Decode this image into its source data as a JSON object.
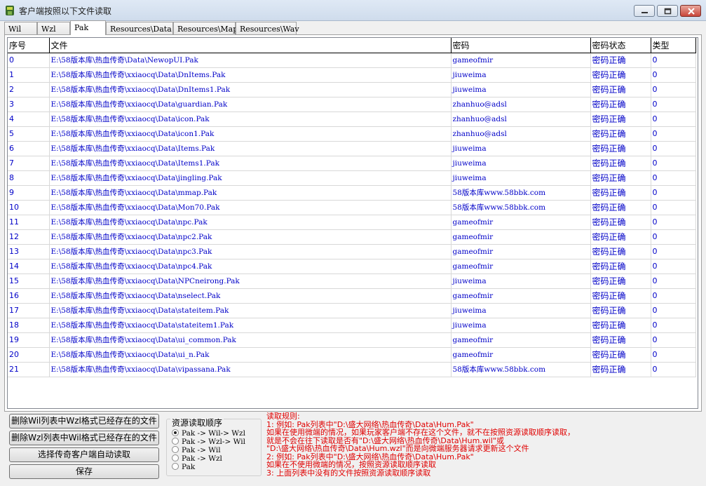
{
  "window": {
    "title": "客户端按照以下文件读取"
  },
  "tabs": [
    "Wil",
    "Wzl",
    "Pak",
    "Resources\\Data",
    "Resources\\Map",
    "Resources\\Wav"
  ],
  "active_tab": "Pak",
  "table": {
    "headers": [
      "序号",
      "文件",
      "密码",
      "密码状态",
      "类型"
    ],
    "rows": [
      [
        "0",
        "E:\\58版本库\\热血传奇\\Data\\NewopUI.Pak",
        "gameofmir",
        "密码正确",
        "0"
      ],
      [
        "1",
        "E:\\58版本库\\热血传奇\\xxiaocq\\Data\\DnItems.Pak",
        "jiuweima",
        "密码正确",
        "0"
      ],
      [
        "2",
        "E:\\58版本库\\热血传奇\\xxiaocq\\Data\\DnItems1.Pak",
        "jiuweima",
        "密码正确",
        "0"
      ],
      [
        "3",
        "E:\\58版本库\\热血传奇\\xxiaocq\\Data\\guardian.Pak",
        "zhanhuo@adsl",
        "密码正确",
        "0"
      ],
      [
        "4",
        "E:\\58版本库\\热血传奇\\xxiaocq\\Data\\icon.Pak",
        "zhanhuo@adsl",
        "密码正确",
        "0"
      ],
      [
        "5",
        "E:\\58版本库\\热血传奇\\xxiaocq\\Data\\icon1.Pak",
        "zhanhuo@adsl",
        "密码正确",
        "0"
      ],
      [
        "6",
        "E:\\58版本库\\热血传奇\\xxiaocq\\Data\\Items.Pak",
        "jiuweima",
        "密码正确",
        "0"
      ],
      [
        "7",
        "E:\\58版本库\\热血传奇\\xxiaocq\\Data\\Items1.Pak",
        "jiuweima",
        "密码正确",
        "0"
      ],
      [
        "8",
        "E:\\58版本库\\热血传奇\\xxiaocq\\Data\\jingling.Pak",
        "jiuweima",
        "密码正确",
        "0"
      ],
      [
        "9",
        "E:\\58版本库\\热血传奇\\xxiaocq\\Data\\mmap.Pak",
        "58版本库www.58bbk.com",
        "密码正确",
        "0"
      ],
      [
        "10",
        "E:\\58版本库\\热血传奇\\xxiaocq\\Data\\Mon70.Pak",
        "58版本库www.58bbk.com",
        "密码正确",
        "0"
      ],
      [
        "11",
        "E:\\58版本库\\热血传奇\\xxiaocq\\Data\\npc.Pak",
        "gameofmir",
        "密码正确",
        "0"
      ],
      [
        "12",
        "E:\\58版本库\\热血传奇\\xxiaocq\\Data\\npc2.Pak",
        "gameofmir",
        "密码正确",
        "0"
      ],
      [
        "13",
        "E:\\58版本库\\热血传奇\\xxiaocq\\Data\\npc3.Pak",
        "gameofmir",
        "密码正确",
        "0"
      ],
      [
        "14",
        "E:\\58版本库\\热血传奇\\xxiaocq\\Data\\npc4.Pak",
        "gameofmir",
        "密码正确",
        "0"
      ],
      [
        "15",
        "E:\\58版本库\\热血传奇\\xxiaocq\\Data\\NPCneirong.Pak",
        "jiuweima",
        "密码正确",
        "0"
      ],
      [
        "16",
        "E:\\58版本库\\热血传奇\\xxiaocq\\Data\\nselect.Pak",
        "gameofmir",
        "密码正确",
        "0"
      ],
      [
        "17",
        "E:\\58版本库\\热血传奇\\xxiaocq\\Data\\stateitem.Pak",
        "jiuweima",
        "密码正确",
        "0"
      ],
      [
        "18",
        "E:\\58版本库\\热血传奇\\xxiaocq\\Data\\stateitem1.Pak",
        "jiuweima",
        "密码正确",
        "0"
      ],
      [
        "19",
        "E:\\58版本库\\热血传奇\\xxiaocq\\Data\\ui_common.Pak",
        "gameofmir",
        "密码正确",
        "0"
      ],
      [
        "20",
        "E:\\58版本库\\热血传奇\\xxiaocq\\Data\\ui_n.Pak",
        "gameofmir",
        "密码正确",
        "0"
      ],
      [
        "21",
        "E:\\58版本库\\热血传奇\\xxiaocq\\Data\\vipassana.Pak",
        "58版本库www.58bbk.com",
        "密码正确",
        "0"
      ]
    ]
  },
  "buttons": {
    "delete_wil": "删除Wil列表中Wzl格式已经存在的文件",
    "delete_wzl": "删除Wzl列表中Wil格式已经存在的文件",
    "auto_read": "选择传奇客户端自动读取",
    "save": "保存"
  },
  "order_group": {
    "title": "资源读取顺序",
    "options": [
      "Pak -> Wil-> Wzl",
      "Pak -> Wzl-> Wil",
      "Pak -> Wil",
      "Pak -> Wzl",
      "Pak"
    ],
    "selected": 0
  },
  "rules": [
    "读取规则:",
    "1: 例如: Pak列表中\"D:\\盛大网络\\热血传奇\\Data\\Hum.Pak\"",
    "    如果在使用微端的情况，如果玩家客户端不存在这个文件，就不在按照资源读取顺序读取，",
    "    就是不会在往下读取是否有\"D:\\盛大网络\\热血传奇\\Data\\Hum.wil\"或",
    "    \"D:\\盛大网络\\热血传奇\\Data\\Hum.wzl\"而是向微端服务器请求更新这个文件",
    "2: 例如: Pak列表中\"D:\\盛大网络\\热血传奇\\Data\\Hum.Pak\"",
    "    如果在不使用微端的情况，按照资源读取顺序读取",
    "3: 上面列表中没有的文件按照资源读取顺序读取"
  ]
}
